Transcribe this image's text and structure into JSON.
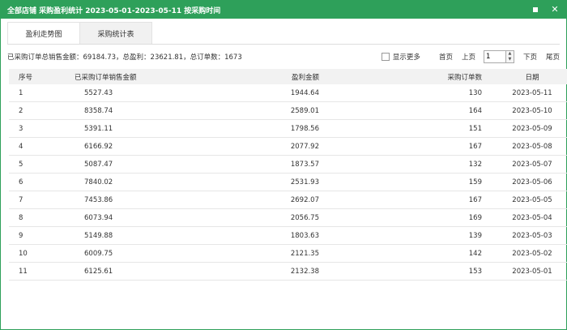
{
  "window": {
    "title": "全部店铺 采购盈利统计 2023-05-01-2023-05-11 按采购时间"
  },
  "tabs": [
    {
      "label": "盈利走势图",
      "active": false
    },
    {
      "label": "采购统计表",
      "active": true
    }
  ],
  "summary": "已采购订单总销售金额：69184.73，总盈利：23621.81，总订单数：1673",
  "pager": {
    "show_more": "显示更多",
    "first": "首页",
    "prev": "上页",
    "page": "1",
    "next": "下页",
    "last": "尾页"
  },
  "table": {
    "headers": [
      "序号",
      "已采购订单销售金额",
      "盈利金额",
      "采购订单数",
      "日期"
    ],
    "rows": [
      [
        "1",
        "5527.43",
        "1944.64",
        "130",
        "2023-05-11"
      ],
      [
        "2",
        "8358.74",
        "2589.01",
        "164",
        "2023-05-10"
      ],
      [
        "3",
        "5391.11",
        "1798.56",
        "151",
        "2023-05-09"
      ],
      [
        "4",
        "6166.92",
        "2077.92",
        "167",
        "2023-05-08"
      ],
      [
        "5",
        "5087.47",
        "1873.57",
        "132",
        "2023-05-07"
      ],
      [
        "6",
        "7840.02",
        "2531.93",
        "159",
        "2023-05-06"
      ],
      [
        "7",
        "7453.86",
        "2692.07",
        "167",
        "2023-05-05"
      ],
      [
        "8",
        "6073.94",
        "2056.75",
        "169",
        "2023-05-04"
      ],
      [
        "9",
        "5149.88",
        "1803.63",
        "139",
        "2023-05-03"
      ],
      [
        "10",
        "6009.75",
        "2121.35",
        "142",
        "2023-05-02"
      ],
      [
        "11",
        "6125.61",
        "2132.38",
        "153",
        "2023-05-01"
      ]
    ]
  }
}
